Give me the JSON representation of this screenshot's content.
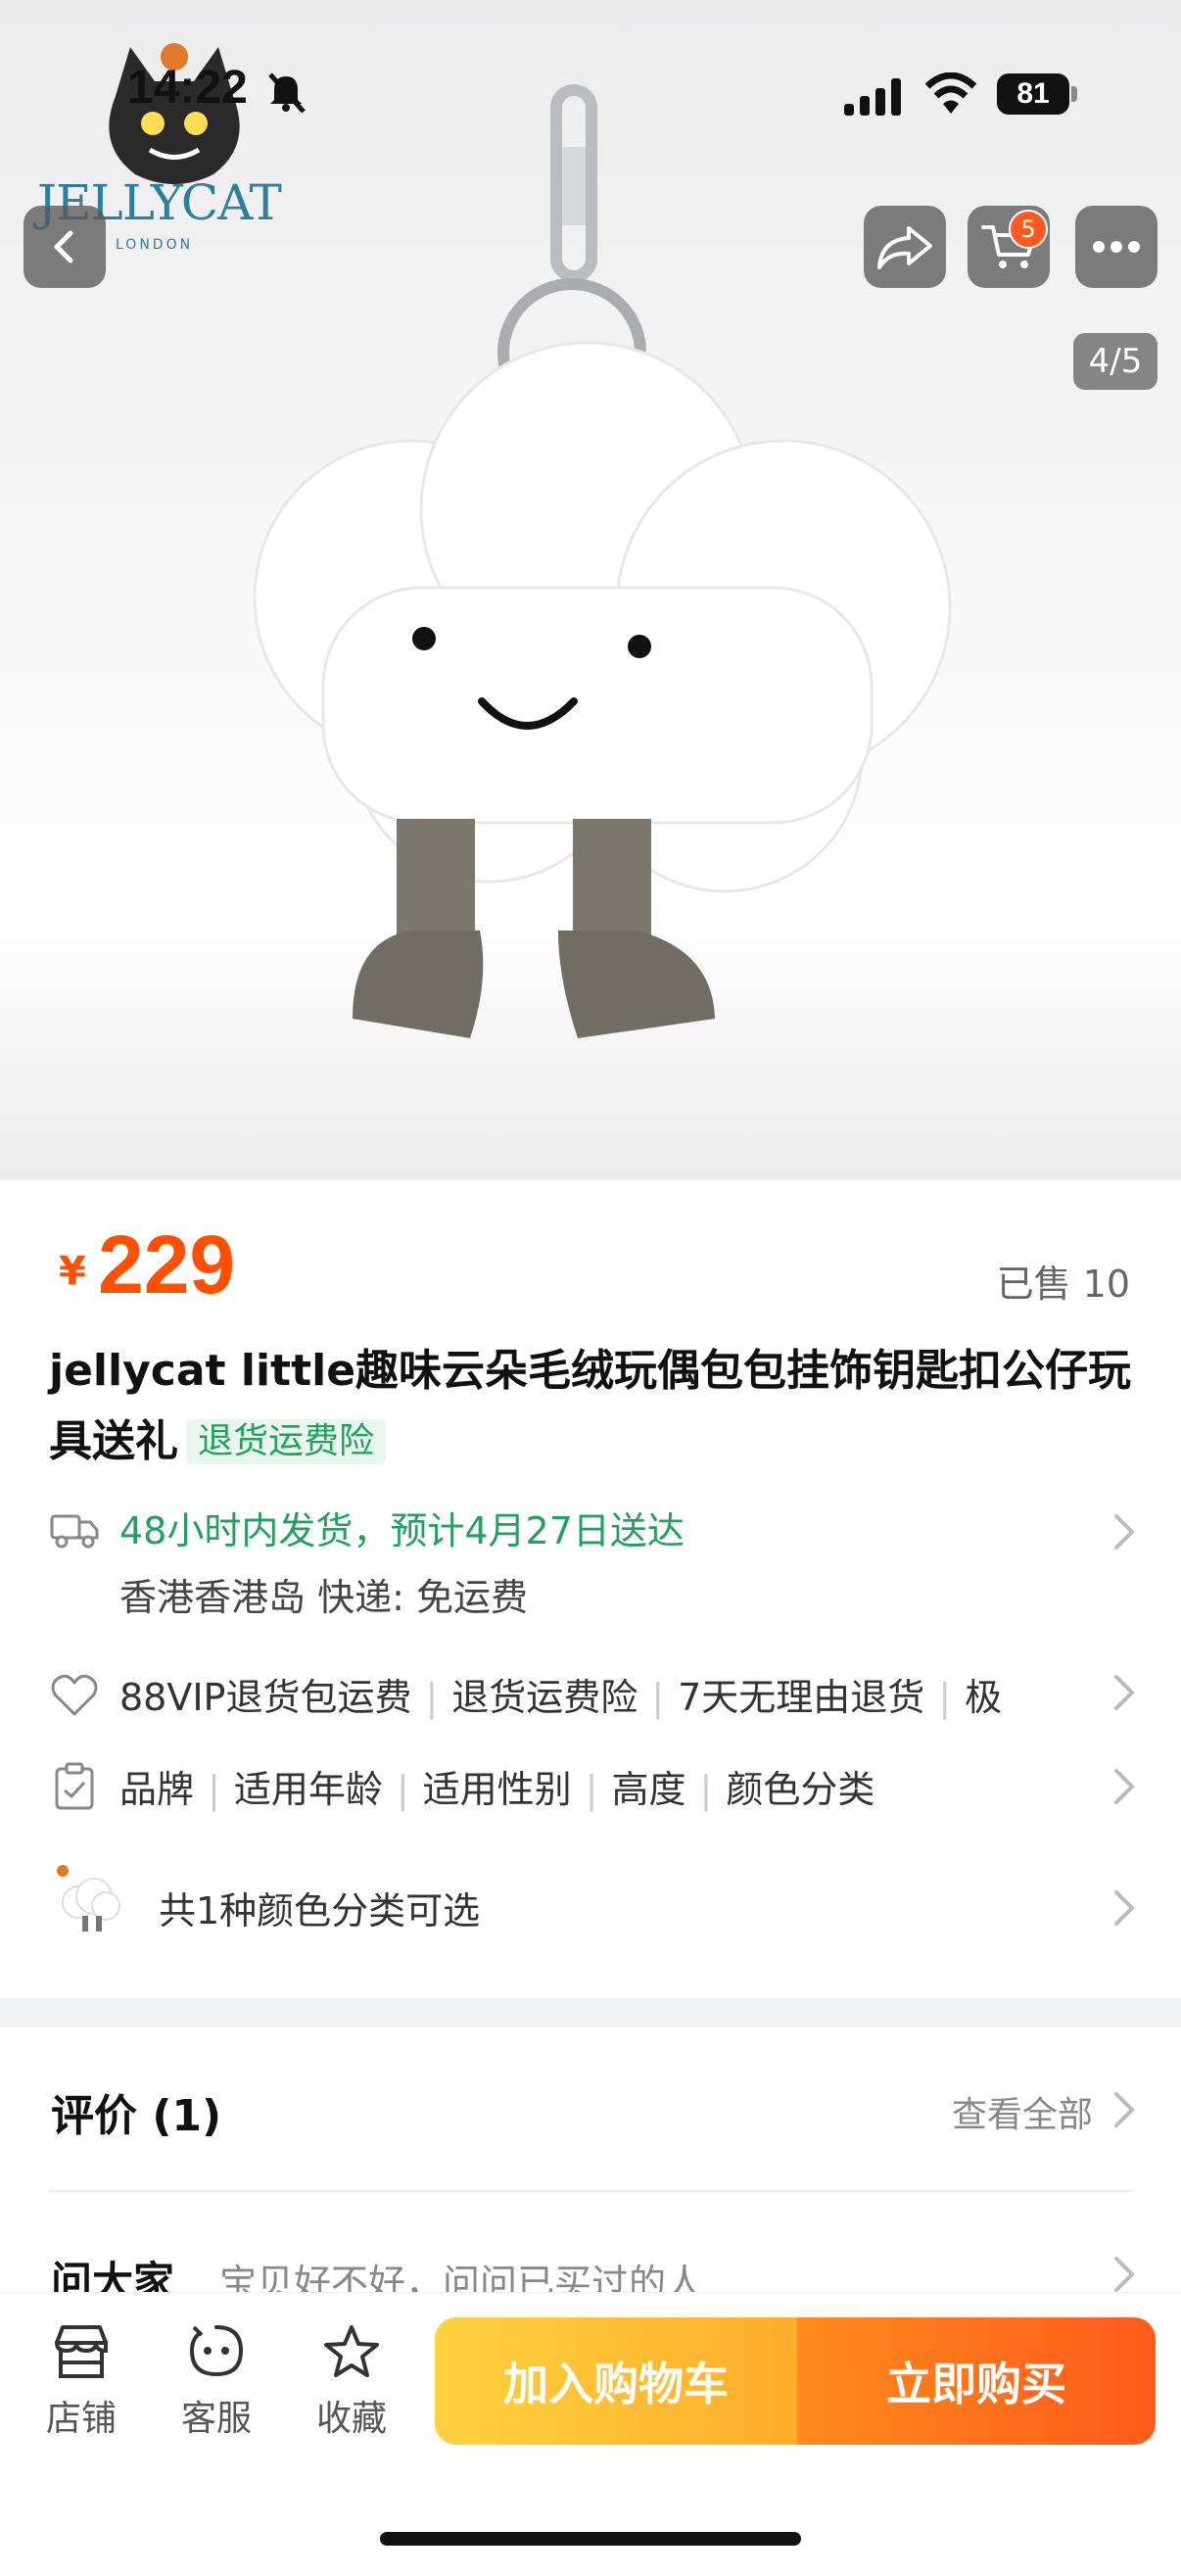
{
  "status_bar": {
    "time": "14:22",
    "battery": "81"
  },
  "hero": {
    "brand_name": "JELLYCAT",
    "brand_sub": "LONDON",
    "cart_badge": "5",
    "image_counter": "4/5"
  },
  "product": {
    "price_symbol": "¥",
    "price": "229",
    "sold": "已售 10",
    "title": "jellycat little趣味云朵毛绒玩偶包包挂饰钥匙扣公仔玩具送礼",
    "title_tag": "退货运费险"
  },
  "shipping": {
    "line1": "48小时内发货，预计4月27日送达",
    "line2": "香港香港岛  快递: 免运费"
  },
  "services": [
    "88VIP退货包运费",
    "退货运费险",
    "7天无理由退货",
    "极"
  ],
  "params": [
    "品牌",
    "适用年龄",
    "适用性别",
    "高度",
    "颜色分类"
  ],
  "sku": {
    "label": "共1种颜色分类可选"
  },
  "reviews": {
    "title": "评价 (1)",
    "see_all": "查看全部"
  },
  "qa": {
    "title": "问大家",
    "subtitle": "宝贝好不好，问问已买过的人"
  },
  "bottom_bar": {
    "tabs": [
      {
        "label": "店铺",
        "icon": "shop-icon"
      },
      {
        "label": "客服",
        "icon": "customer-service-icon"
      },
      {
        "label": "收藏",
        "icon": "star-icon"
      }
    ],
    "add_to_cart": "加入购物车",
    "buy_now": "立即购买"
  },
  "colors": {
    "accent": "#ff5000",
    "green": "#23a061",
    "cart_btn": "#ffbe33",
    "buy_btn": "#ff6a1c"
  }
}
